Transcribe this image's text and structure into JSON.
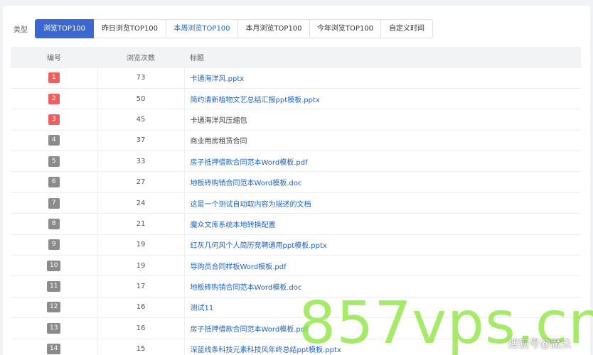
{
  "filter": {
    "label": "类型",
    "tabs": [
      {
        "label": "浏览TOP100",
        "active": true
      },
      {
        "label": "昨日浏览TOP100",
        "active": false
      },
      {
        "label": "本周浏览TOP100",
        "active": false
      },
      {
        "label": "本月浏览TOP100",
        "active": false
      },
      {
        "label": "今年浏览TOP100",
        "active": false
      },
      {
        "label": "自定义时间",
        "active": false
      }
    ]
  },
  "table": {
    "headers": {
      "rank": "编号",
      "views": "浏览次数",
      "title": "标题"
    },
    "rows": [
      {
        "rank": "1",
        "views": "73",
        "title": "卡通海洋风.pptx",
        "link": true
      },
      {
        "rank": "2",
        "views": "50",
        "title": "简约清新植物文艺总结汇报ppt模板.pptx",
        "link": true
      },
      {
        "rank": "3",
        "views": "45",
        "title": "卡通海洋风压缩包",
        "link": false
      },
      {
        "rank": "4",
        "views": "37",
        "title": "商业用房租赁合同",
        "link": false
      },
      {
        "rank": "5",
        "views": "33",
        "title": "房子抵押借款合同范本Word模板.pdf",
        "link": true
      },
      {
        "rank": "6",
        "views": "27",
        "title": "地板砖购销合同范本Word模板.doc",
        "link": true
      },
      {
        "rank": "7",
        "views": "24",
        "title": "这是一个测试自动取内容为描述的文档",
        "link": true
      },
      {
        "rank": "8",
        "views": "21",
        "title": "魔众文库系统本地转换配置",
        "link": true
      },
      {
        "rank": "9",
        "views": "19",
        "title": "红灰几何风个人简历竞聘通用ppt模板.pptx",
        "link": true
      },
      {
        "rank": "10",
        "views": "19",
        "title": "导购员合同样板Word模板.pdf",
        "link": true
      },
      {
        "rank": "11",
        "views": "17",
        "title": "地板砖购销合同范本Word模板.doc",
        "link": true
      },
      {
        "rank": "12",
        "views": "16",
        "title": "测试11",
        "link": true
      },
      {
        "rank": "13",
        "views": "16",
        "title": "房子抵押借款合同范本Word模板.pdf",
        "link": true
      },
      {
        "rank": "14",
        "views": "15",
        "title": "深蓝线条科技元素科技风年终总结ppt模板.pptx",
        "link": true
      }
    ]
  },
  "watermark": {
    "big": "857vps.cn",
    "small": "搜狐号@魔众"
  }
}
